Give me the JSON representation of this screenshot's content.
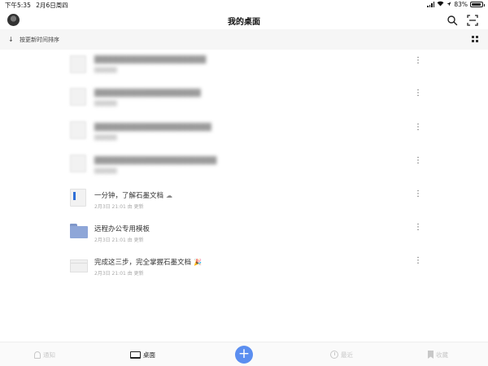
{
  "status_bar": {
    "time": "下午5:35",
    "date": "2月6日周四",
    "battery": "83%"
  },
  "header": {
    "title": "我的桌面"
  },
  "sort": {
    "label": "按更新时间排序"
  },
  "files": [
    {
      "name": "█████████████████████",
      "meta": "██████",
      "icon": "doc-icon",
      "obscured": true
    },
    {
      "name": "████████████████████",
      "meta": "██████",
      "icon": "doc-icon",
      "obscured": true
    },
    {
      "name": "██████████████████████",
      "meta": "██████",
      "icon": "doc-icon",
      "obscured": true
    },
    {
      "name": "███████████████████████",
      "meta": "██████",
      "icon": "doc-icon",
      "obscured": true
    },
    {
      "name": "一分钟，了解石墨文档",
      "meta": "2月3日 21:01 由 更新",
      "icon": "doc-icon",
      "badge": "☁",
      "obscured": false
    },
    {
      "name": "远程办公专用模板",
      "meta": "2月3日 21:01 由 更新",
      "icon": "folder-icon",
      "obscured": false
    },
    {
      "name": "完成这三步，完全掌握石墨文档",
      "meta": "2月3日 21:01 由 更新",
      "icon": "sheet-icon",
      "badge": "🎉",
      "obscured": false
    }
  ],
  "more_glyph": "⋮",
  "tabs": {
    "notify": "通知",
    "desktop": "桌面",
    "recent": "最近",
    "favorites": "收藏",
    "add": "+"
  },
  "colors": {
    "accent": "#5b8ef0",
    "folder": "#8ea6d8"
  }
}
